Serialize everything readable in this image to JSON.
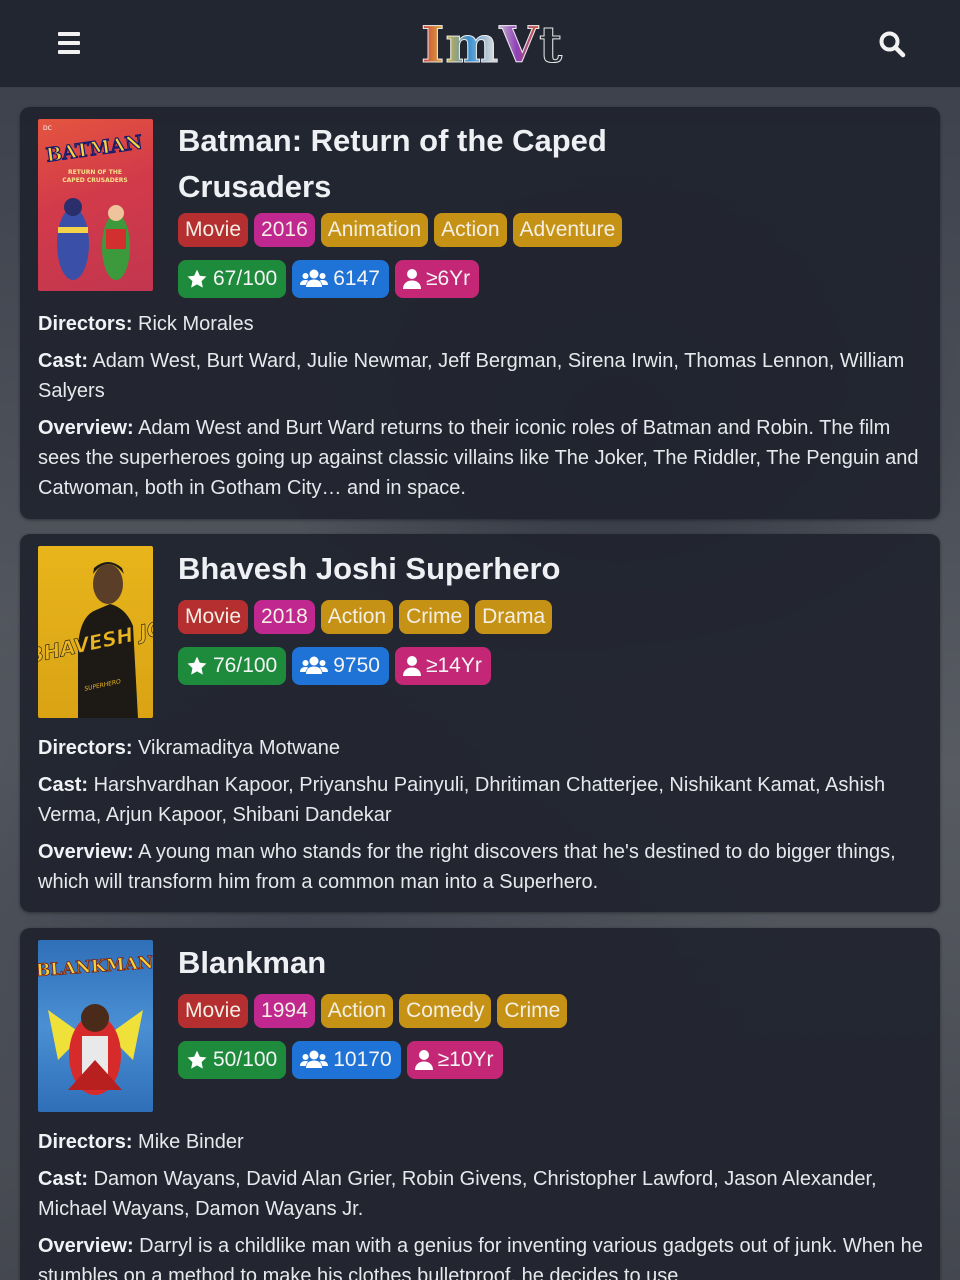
{
  "header": {
    "logo_text": "ImVt",
    "menu_icon": "hamburger-icon",
    "search_icon": "search-icon"
  },
  "labels": {
    "directors": "Directors:",
    "cast": "Cast:",
    "overview": "Overview:"
  },
  "movies": [
    {
      "title": "Batman: Return of the Caped Crusaders",
      "type": "Movie",
      "year": "2016",
      "genres": [
        "Animation",
        "Action",
        "Adventure"
      ],
      "rating": "67/100",
      "votes": "6147",
      "age": "≥6Yr",
      "poster_text": "BATMAN",
      "poster_subtext": "RETURN OF THE CAPED CRUSADERS",
      "directors": "Rick Morales",
      "cast": "Adam West, Burt Ward, Julie Newmar, Jeff Bergman, Sirena Irwin, Thomas Lennon, William Salyers",
      "overview": "Adam West and Burt Ward returns to their iconic roles of Batman and Robin. The film sees the superheroes going up against classic villains like The Joker, The Riddler, The Penguin and Catwoman, both in Gotham City… and in space."
    },
    {
      "title": "Bhavesh Joshi Superhero",
      "type": "Movie",
      "year": "2018",
      "genres": [
        "Action",
        "Crime",
        "Drama"
      ],
      "rating": "76/100",
      "votes": "9750",
      "age": "≥14Yr",
      "poster_text": "BHAVESH JOSHI",
      "poster_subtext": "SUPERHERO",
      "directors": "Vikramaditya Motwane",
      "cast": "Harshvardhan Kapoor, Priyanshu Painyuli, Dhritiman Chatterjee, Nishikant Kamat, Ashish Verma, Arjun Kapoor, Shibani Dandekar",
      "overview": "A young man who stands for the right discovers that he's destined to do bigger things, which will transform him from a common man into a Superhero."
    },
    {
      "title": "Blankman",
      "type": "Movie",
      "year": "1994",
      "genres": [
        "Action",
        "Comedy",
        "Crime"
      ],
      "rating": "50/100",
      "votes": "10170",
      "age": "≥10Yr",
      "poster_text": "BLANKMAN",
      "directors": "Mike Binder",
      "cast": "Damon Wayans, David Alan Grier, Robin Givens, Christopher Lawford, Jason Alexander, Michael Wayans, Damon Wayans Jr.",
      "overview": "Darryl is a childlike man with a genius for inventing various gadgets out of junk. When he stumbles on a method to make his clothes bulletproof, he decides to use"
    }
  ],
  "colors": {
    "header_bg": "#222631",
    "card_bg": "#20242e",
    "type_tag": "#b52f31",
    "year_tag": "#c0288f",
    "genre_tag": "#c69215",
    "rating_badge": "#1d8a3c",
    "votes_badge": "#1f73d6",
    "age_badge": "#c52777"
  }
}
